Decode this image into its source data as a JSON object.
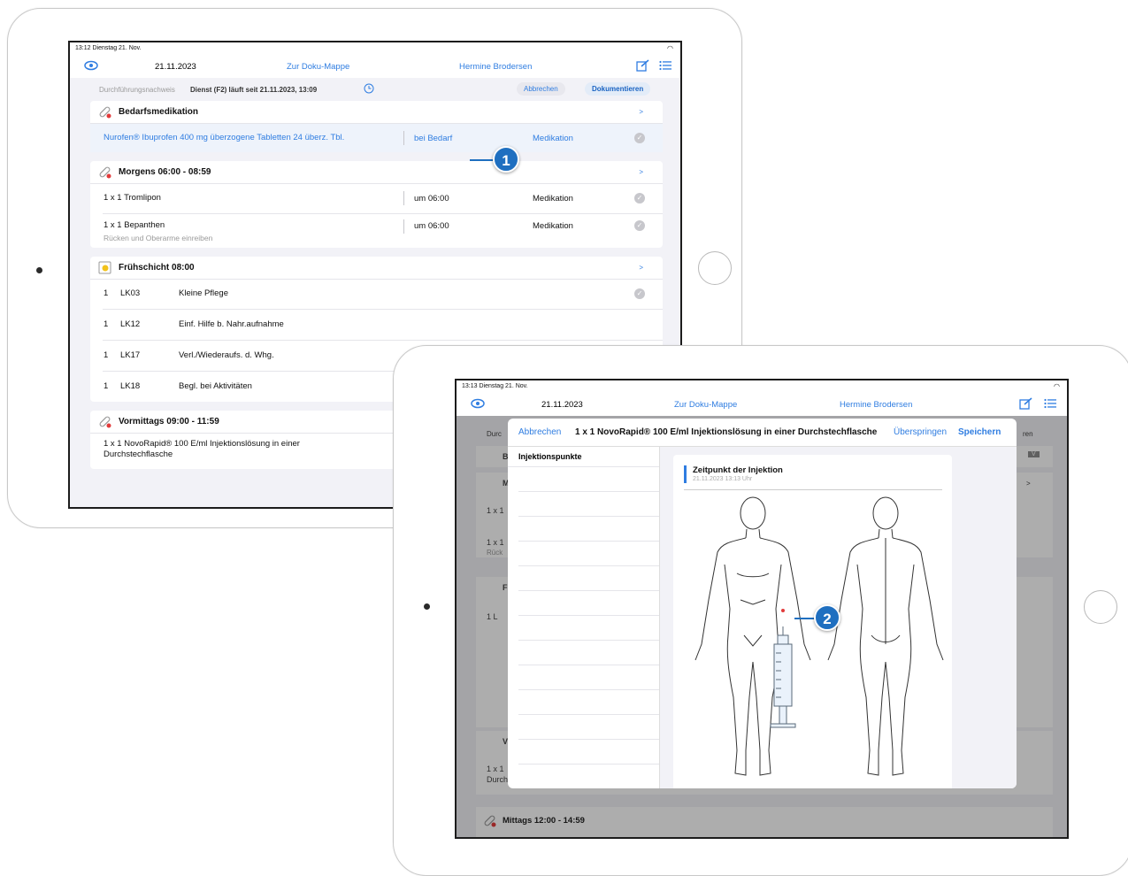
{
  "screen1": {
    "status_time": "13:12  Dienstag 21. Nov.",
    "nav": {
      "date": "21.11.2023",
      "doku": "Zur Doku-Mappe",
      "patient": "Hermine Brodersen"
    },
    "sub": {
      "label": "Durchführungsnachweis",
      "dienst": "Dienst (F2) läuft seit 21.11.2023, 13:09",
      "cancel": "Abbrechen",
      "document": "Dokumentieren"
    },
    "sections": {
      "bedarf": {
        "title": "Bedarfsmedikation",
        "chev": ">",
        "row": {
          "name": "Nurofen® Ibuprofen 400 mg überzogene Tabletten 24 überz. Tbl.",
          "when": "bei Bedarf",
          "type": "Medikation"
        }
      },
      "morgens": {
        "title": "Morgens 06:00 - 08:59",
        "chev": ">",
        "rows": [
          {
            "name": "1 x 1 Tromlipon",
            "when": "um 06:00",
            "type": "Medikation"
          },
          {
            "name": "1 x 1 Bepanthen",
            "note": "Rücken und Oberarme einreiben",
            "when": "um 06:00",
            "type": "Medikation"
          }
        ]
      },
      "frueh": {
        "title": "Frühschicht 08:00",
        "chev": ">",
        "rows": [
          {
            "qty": "1",
            "code": "LK03",
            "text": "Kleine Pflege"
          },
          {
            "qty": "1",
            "code": "LK12",
            "text": "Einf. Hilfe b. Nahr.aufnahme"
          },
          {
            "qty": "1",
            "code": "LK17",
            "text": "Verl./Wiederaufs. d. Whg."
          },
          {
            "qty": "1",
            "code": "LK18",
            "text": "Begl. bei Aktivitäten"
          }
        ]
      },
      "vormittags": {
        "title": "Vormittags 09:00 - 11:59",
        "row1": "1 x 1 NovoRapid® 100 E/ml Injektionslösung in einer",
        "row2": "Durchstechflasche"
      }
    },
    "callout": "1"
  },
  "screen2": {
    "status_time": "13:13  Dienstag 21. Nov.",
    "nav": {
      "date": "21.11.2023",
      "doku": "Zur Doku-Mappe",
      "patient": "Hermine Brodersen"
    },
    "modal": {
      "cancel": "Abbrechen",
      "title": "1 x 1 NovoRapid® 100 E/ml Injektionslösung in einer Durchstechflasche",
      "skip": "Überspringen",
      "save": "Speichern",
      "left_label": "Injektionspunkte",
      "card_title": "Zeitpunkt der Injektion",
      "card_time": "21.11.2023 13:13 Uhr"
    },
    "under": {
      "durc": "Durc",
      "b": "B",
      "m": "M",
      "r1": "1 x 1",
      "r2": "1 x 1",
      "rueck": "Rück",
      "f": "F",
      "l": "1   L",
      "v": "V",
      "r3": "1 x 1",
      "durch": "Durchstechflasche",
      "ren": "ren",
      "v_badge": "V",
      "chev": ">",
      "mittags": "Mittags 12:00 - 14:59"
    },
    "callout": "2"
  }
}
